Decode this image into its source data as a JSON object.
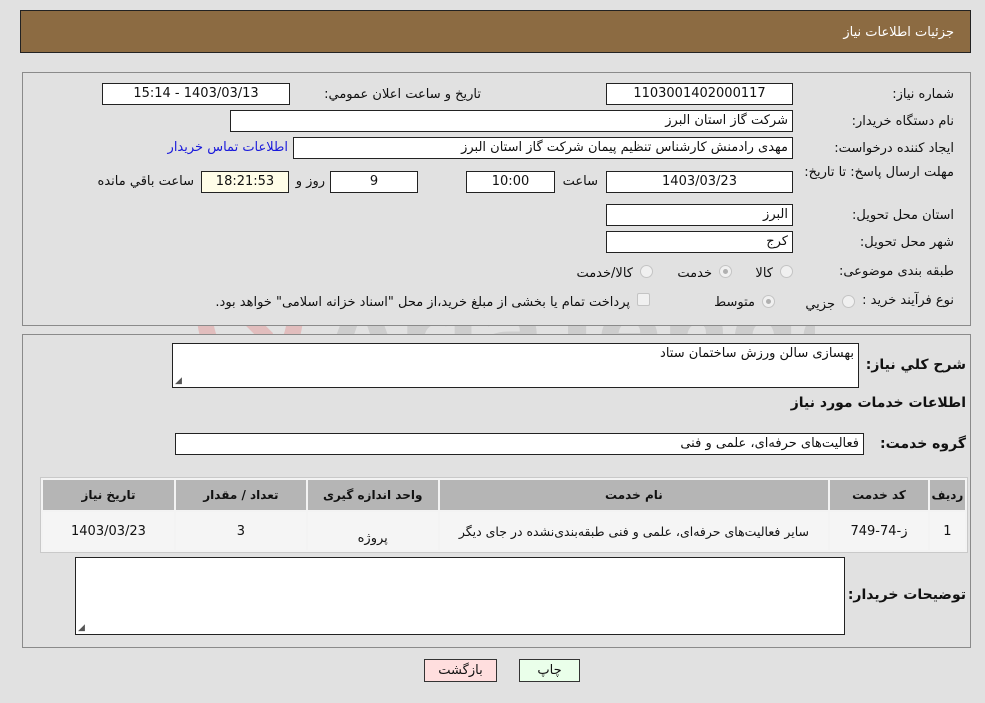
{
  "header": {
    "title": "جزئیات اطلاعات نیاز"
  },
  "fields": {
    "need_number_label": "شماره نیاز:",
    "need_number": "1103001402000117",
    "announce_label": "تاريخ و ساعت اعلان عمومي:",
    "announce_value": "1403/03/13 - 15:14",
    "buyer_org_label": "نام دستگاه خریدار:",
    "buyer_org": "شرکت گاز استان البرز",
    "creator_label": "ایجاد کننده درخواست:",
    "creator": "مهدی رادمنش کارشناس تنظیم پیمان شرکت گاز استان البرز",
    "contact_link": "اطلاعات تماس خریدار",
    "deadline_label": "مهلت ارسال پاسخ: تا تاریخ:",
    "deadline_date": "1403/03/23",
    "time_label": "ساعت",
    "deadline_time": "10:00",
    "days_value": "9",
    "days_label": "روز و",
    "remaining_time": "18:21:53",
    "remaining_label": "ساعت باقي مانده",
    "province_label": "استان محل تحویل:",
    "province": "البرز",
    "city_label": "شهر محل تحویل:",
    "city": "کرج",
    "category_label": "طبقه بندی موضوعی:",
    "category_options": [
      {
        "label": "کالا",
        "selected": false
      },
      {
        "label": "خدمت",
        "selected": true
      },
      {
        "label": "کالا/خدمت",
        "selected": false
      }
    ],
    "process_label": "نوع فرآیند خرید :",
    "process_options": [
      {
        "label": "جزيي",
        "selected": false
      },
      {
        "label": "متوسط",
        "selected": true
      }
    ],
    "payment_note": "پرداخت تمام یا بخشی از مبلغ خرید،از محل \"اسناد خزانه اسلامی\" خواهد بود.",
    "payment_checked": false
  },
  "details": {
    "summary_label": "شرح کلي نياز:",
    "summary": "بهسازی سالن ورزش ساختمان ستاد",
    "services_heading": "اطلاعات خدمات مورد نیاز",
    "service_group_label": "گروه خدمت:",
    "service_group": "فعالیت‌های حرفه‌ای، علمی و فنی",
    "table": {
      "headers": [
        "ردیف",
        "کد خدمت",
        "نام خدمت",
        "واحد اندازه گیری",
        "تعداد / مقدار",
        "تاریخ نیاز"
      ],
      "rows": [
        [
          "1",
          "ز-74-749",
          "سایر فعالیت‌های حرفه‌ای، علمی و فنی طبقه‌بندی‌نشده در جای دیگر",
          "پروژه",
          "3",
          "1403/03/23"
        ]
      ]
    },
    "buyer_notes_label": "توضیحات خریدار:",
    "buyer_notes": ""
  },
  "buttons": {
    "print": "چاپ",
    "back": "بازگشت"
  },
  "watermark": {
    "text": "AriaTender.neT"
  }
}
